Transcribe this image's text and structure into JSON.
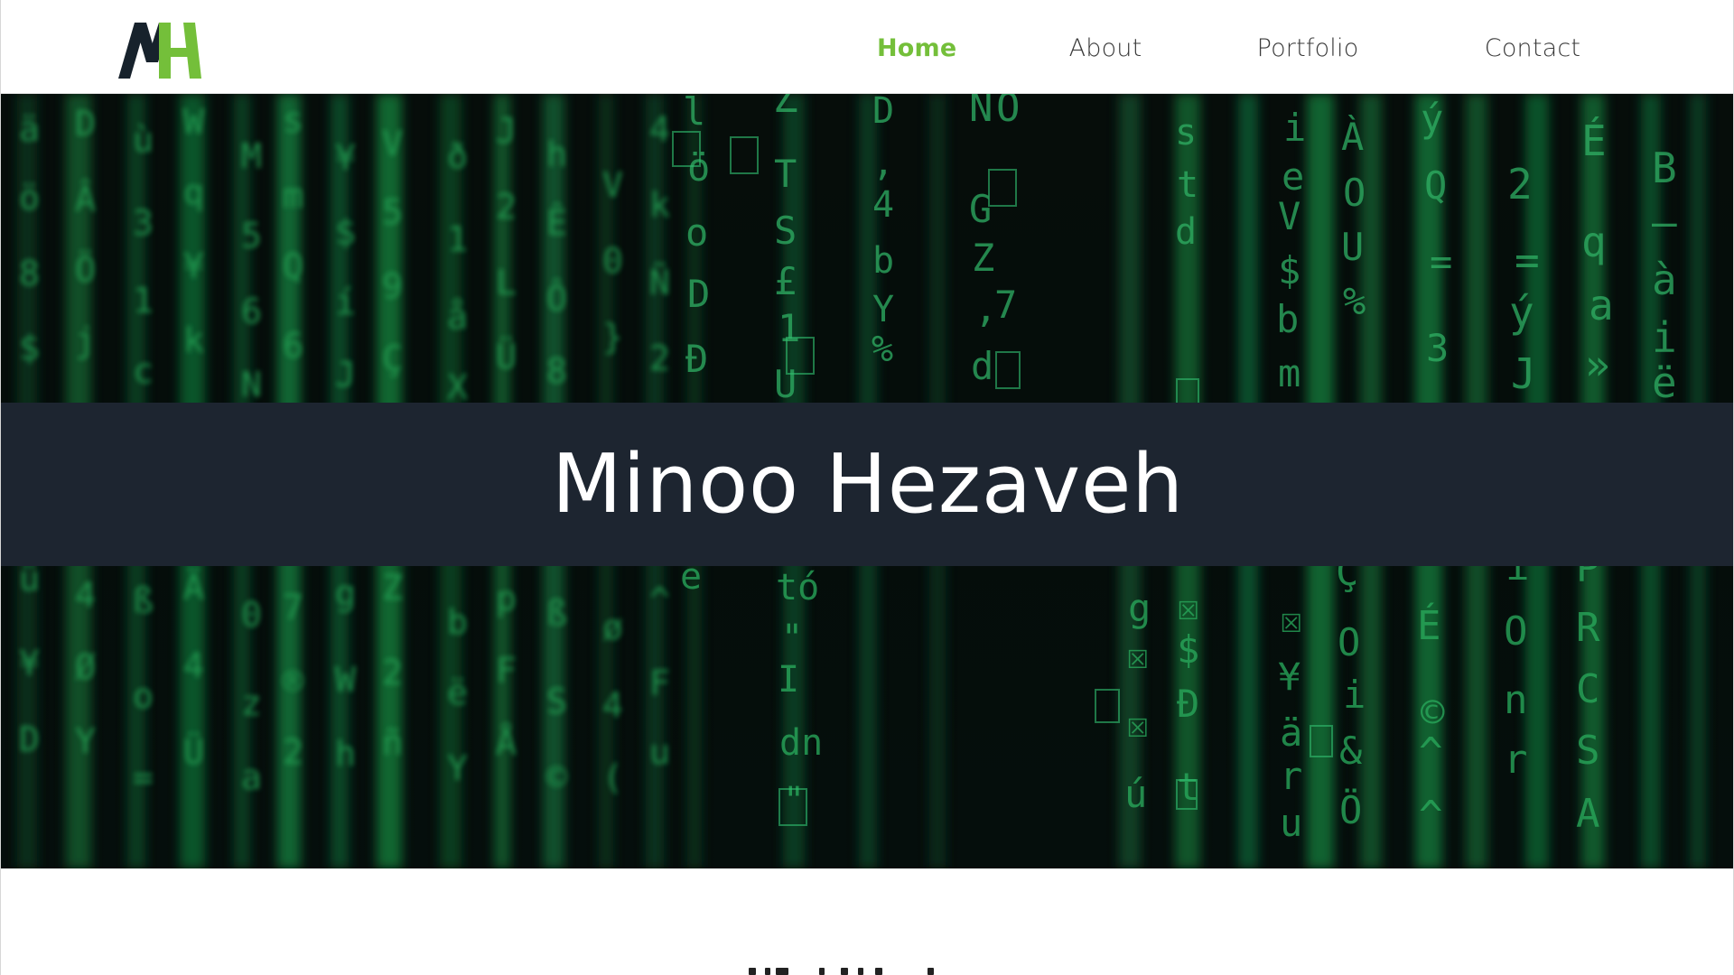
{
  "header": {
    "logo_alt": "MH",
    "nav": [
      {
        "label": "Home",
        "active": true
      },
      {
        "label": "About",
        "active": false
      },
      {
        "label": "Portfolio",
        "active": false
      },
      {
        "label": "Contact",
        "active": false
      }
    ]
  },
  "hero": {
    "title": "Minoo Hezaveh"
  },
  "colors": {
    "accent": "#74bf3a",
    "banner": "#1d2530",
    "nav_text": "#3b3b3b",
    "matrix_green": "#25b35a"
  },
  "icons": {
    "logo": "mh-logo-icon"
  }
}
